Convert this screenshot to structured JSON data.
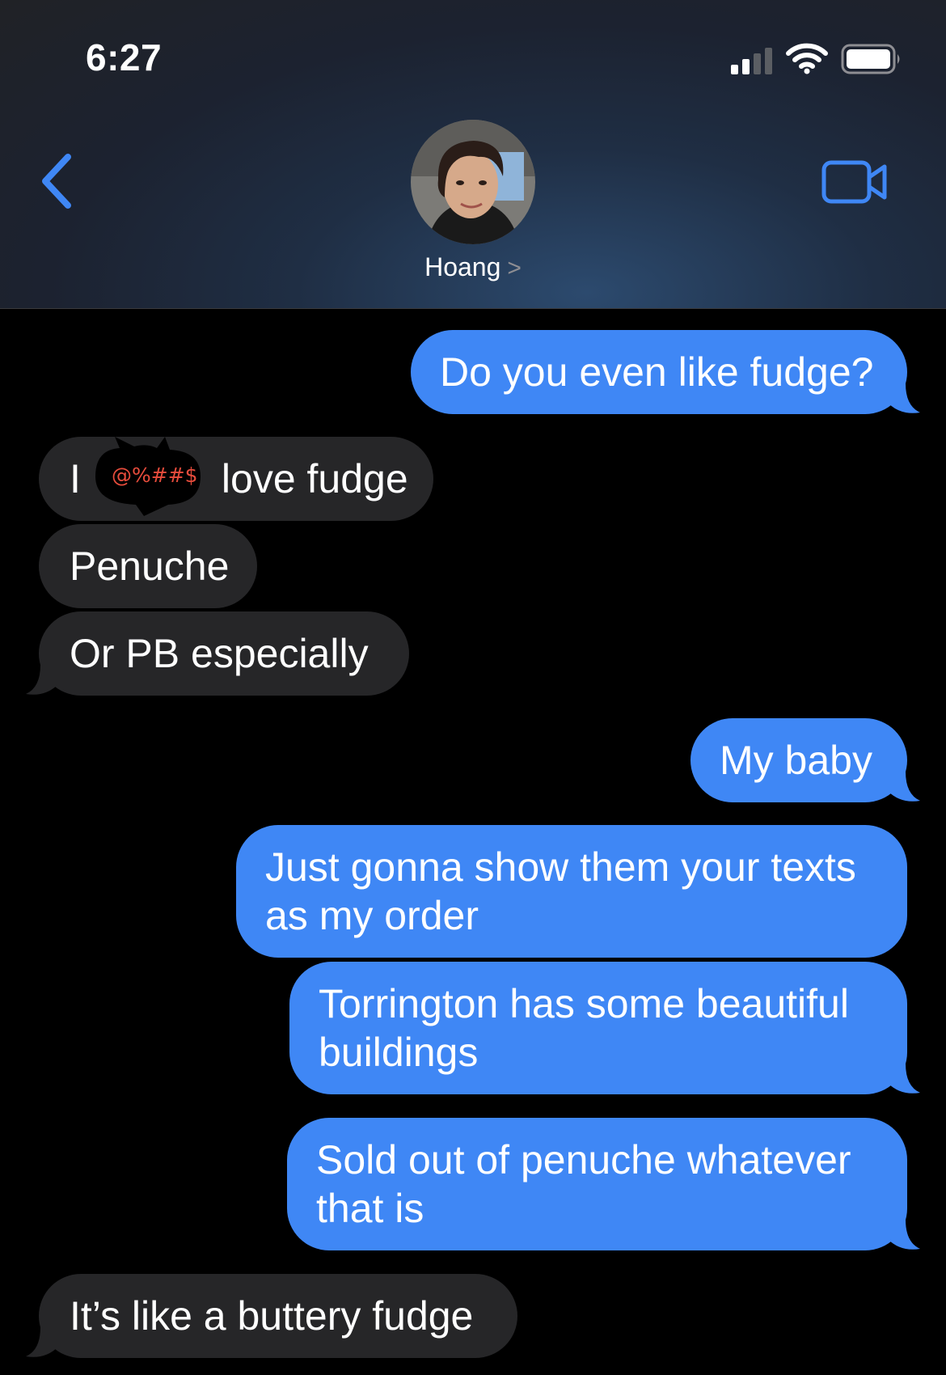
{
  "status_bar": {
    "time": "6:27",
    "signal_icon": "cellular-signal-icon",
    "wifi_icon": "wifi-icon",
    "battery_icon": "battery-icon"
  },
  "header": {
    "back_icon": "chevron-left-icon",
    "video_icon": "facetime-video-icon",
    "contact_name": "Hoang",
    "contact_chevron": ">"
  },
  "colors": {
    "accent": "#3f87f5",
    "outgoing_bubble": "#3f87f5",
    "incoming_bubble": "#262628",
    "background": "#000000",
    "redaction_text": "#e74c3c"
  },
  "messages": [
    {
      "direction": "outgoing",
      "text": "Do you even like fudge?"
    },
    {
      "direction": "incoming",
      "text_before": "I",
      "redaction": "@%##$",
      "text_after": "love fudge"
    },
    {
      "direction": "incoming",
      "text": "Penuche"
    },
    {
      "direction": "incoming",
      "text": "Or PB especially"
    },
    {
      "direction": "outgoing",
      "text": "My baby"
    },
    {
      "direction": "outgoing",
      "lines": [
        "Just gonna show them your texts",
        "as my order"
      ]
    },
    {
      "direction": "outgoing",
      "lines": [
        "Torrington has some beautiful",
        "buildings"
      ]
    },
    {
      "direction": "outgoing",
      "lines": [
        "Sold out of penuche whatever",
        "that is"
      ]
    },
    {
      "direction": "incoming",
      "text": "It’s like a buttery fudge"
    }
  ]
}
